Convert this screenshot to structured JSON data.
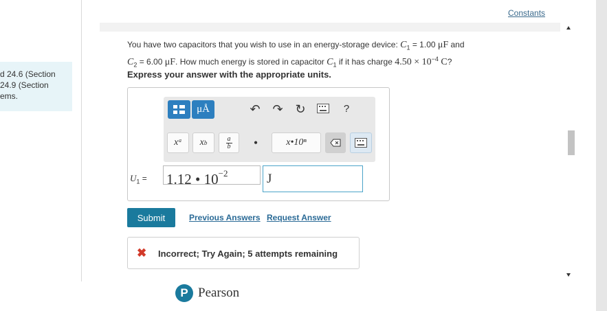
{
  "left_panel": {
    "lines": [
      "d 24.6 (Section",
      " 24.9 (Section",
      "ems."
    ]
  },
  "header": {
    "constants_link": "Constants"
  },
  "question": {
    "intro": "You have two capacitors that you wish to use in an energy-storage device:",
    "c1_label": "C",
    "c1_sub": "1",
    "c1_value": "= 1.00 ",
    "c1_unit": "μF",
    "and": " and",
    "c2_label": "C",
    "c2_sub": "2",
    "c2_value": "= 6.00 ",
    "c2_unit": "μF",
    "ask": ". How much energy is stored in capacitor ",
    "ask_c": "C",
    "ask_c_sub": "1",
    "ask2": " if it has charge ",
    "charge": "4.50 × 10",
    "charge_exp": "−4",
    "charge_unit": " C",
    "ask_end": "?"
  },
  "express": "Express your answer with the appropriate units.",
  "toolbar": {
    "mu_label": "μÅ",
    "undo": "↶",
    "redo": "↷",
    "reset": "↻",
    "help": "?",
    "xa": "xᵃ",
    "xb": "x_b",
    "frac_num": "a",
    "frac_den": "b",
    "dot": "•",
    "sci": "x•10ⁿ",
    "del": "⌫"
  },
  "answer": {
    "label_var": "U",
    "label_sub": "1",
    "label_eq": " =",
    "value": "1.12 • 10",
    "exponent": "−2",
    "units": "J"
  },
  "actions": {
    "submit": "Submit",
    "previous_answers": "Previous Answers",
    "request_answer": "Request Answer"
  },
  "feedback": {
    "icon": "✖",
    "text": "Incorrect; Try Again; 5 attempts remaining"
  },
  "footer": {
    "brand": "Pearson",
    "logo_letter": "P"
  },
  "colors": {
    "accent": "#1a7a9d",
    "toolbar_blue": "#2d7fbf",
    "error": "#d23a2a",
    "link": "#2a6a96"
  }
}
